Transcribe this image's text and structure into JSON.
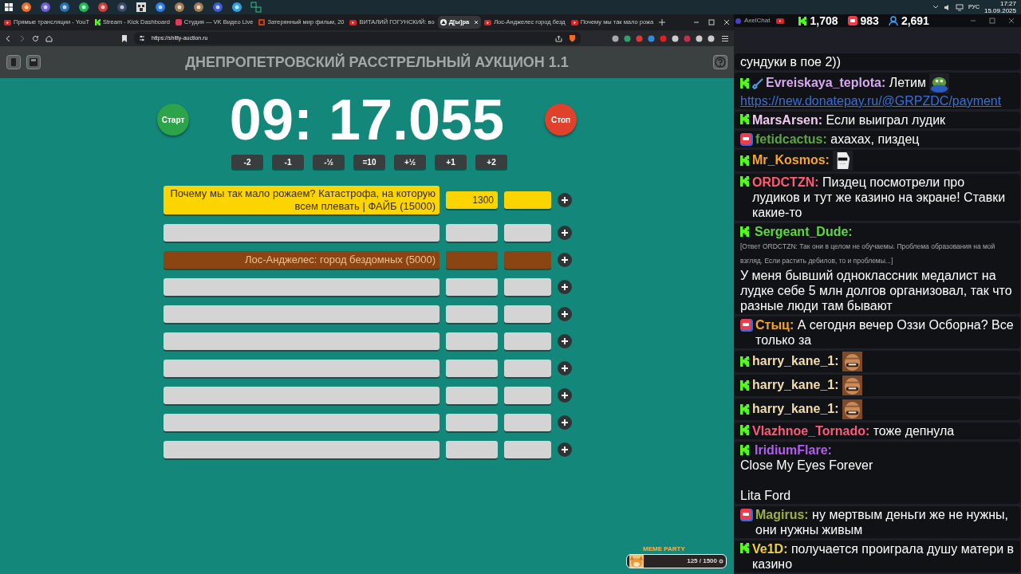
{
  "tray": {
    "language": "РУС",
    "time": "17:27",
    "date": "15.09.2025"
  },
  "browser": {
    "tabs": [
      {
        "title": "Прямые трансляции - YouT",
        "kind": "youtube",
        "selected": false
      },
      {
        "title": "Stream - Kick Dashboard",
        "kind": "kick",
        "selected": false
      },
      {
        "title": "Студия — VK Видео Live",
        "kind": "vk",
        "selected": false
      },
      {
        "title": "Затерянный мир фильм, 20",
        "kind": "film",
        "selected": false
      },
      {
        "title": "ВИТАЛИЙ ГОГУНСКИЙ: во",
        "kind": "youtube",
        "selected": false
      },
      {
        "title": "Д[ы]ра",
        "kind": "site",
        "selected": true
      },
      {
        "title": "Лос-Анджелес город безд",
        "kind": "youtube",
        "selected": false
      },
      {
        "title": "Почему мы так мало рожа",
        "kind": "youtube",
        "selected": false
      }
    ],
    "url": "https://shitty-auction.ru"
  },
  "auction": {
    "title": "ДНЕПРОПЕТРОВСКИЙ РАССТРЕЛЬНЫЙ АУКЦИОН 1.1",
    "timer": "09: 17.055",
    "start": "Старт",
    "stop": "Стоп",
    "steps": [
      "-2",
      "-1",
      "-½",
      "=10",
      "+½",
      "+1",
      "+2"
    ],
    "lots": [
      {
        "name": "Почему мы так мало рожаем? Катастрофа, на которую всем плевать | ФАЙБ (15000)",
        "amount": "1300",
        "color": "#fcd500"
      },
      {
        "color": "#d4d4d4"
      },
      {
        "name": "Лос-Анджелес: город бездомных (5000)",
        "color": "#8b4513"
      },
      {
        "color": "#d4d4d4"
      },
      {
        "color": "#d4d4d4"
      },
      {
        "color": "#d4d4d4"
      },
      {
        "color": "#d4d4d4"
      },
      {
        "color": "#d4d4d4"
      },
      {
        "color": "#d4d4d4"
      },
      {
        "color": "#d4d4d4"
      }
    ]
  },
  "overlay": {
    "title": "MEME PARTY",
    "progress": "125 / 1500"
  },
  "chat": {
    "app": "AxelChat",
    "counts": {
      "kick": "1,708",
      "vk": "983",
      "viewers": "2,691"
    },
    "messages": [
      {
        "text": "сундуки в пое 2))"
      },
      {
        "kind": "kick",
        "badge": true,
        "author": "Evreiskaya_teplota:",
        "color": "#d8a8f0",
        "text": "Летим",
        "emote": true,
        "link": "https://new.donatepay.ru/@GRPZDC/payment"
      },
      {
        "kind": "kick",
        "author": "MarsArsen:",
        "color": "#f2c9ee",
        "text": "Если выиграл лудик"
      },
      {
        "kind": "vk",
        "author": "fetidcactus:",
        "color": "#5aa83a",
        "text": "ахахах, пиздец"
      },
      {
        "kind": "kick",
        "author": "Mr_Kosmos:",
        "color": "#f5a52a",
        "emote": true
      },
      {
        "kind": "kick",
        "author": "ORDCTZN:",
        "color": "#ff5a72",
        "text": "Пиздец посмотрели про лудиков и тут же казино на экране! Ставки какие-то"
      },
      {
        "kind": "kick",
        "author": "Sergeant_Dude:",
        "color": "#5bdc3a",
        "stacked": true,
        "reply": "[Ответ ORDCTZN: Так они в целом не обучаемы. Проблема образования на мой взгляд. Если растить дебилов, то и проблемы...]",
        "text": "У меня бывший одноклассник медалист на лудке себе 5 млн долгов организовал, так что разные люди там бывают"
      },
      {
        "kind": "vk",
        "author": "Стыц:",
        "color": "#f7a51c",
        "text": "А сегодня вечер Оззи Осборна? Все только за"
      },
      {
        "kind": "kick",
        "author": "harry_kane_1:",
        "color": "#f3dca8",
        "emote": true
      },
      {
        "kind": "kick",
        "author": "harry_kane_1:",
        "color": "#f3dca8",
        "emote": true
      },
      {
        "kind": "kick",
        "author": "harry_kane_1:",
        "color": "#f3dca8",
        "emote": true
      },
      {
        "kind": "kick",
        "author": "Vlazhnoe_Tornado:",
        "color": "#ff5a7a",
        "text": "тоже депнула"
      },
      {
        "kind": "kick",
        "author": "IridiumFlare:",
        "color": "#b45cf0",
        "stacked": true,
        "text": "Close My Eyes Forever\n\nLita Ford"
      },
      {
        "kind": "vk",
        "author": "Magirus:",
        "color": "#9cb04a",
        "text": "ну мертвым деньги же не нужны, они нужны живым"
      },
      {
        "kind": "kick",
        "author": "Ve1D:",
        "color": "#f2d22e",
        "text": "получается проиграла душу матери в казино"
      }
    ]
  }
}
